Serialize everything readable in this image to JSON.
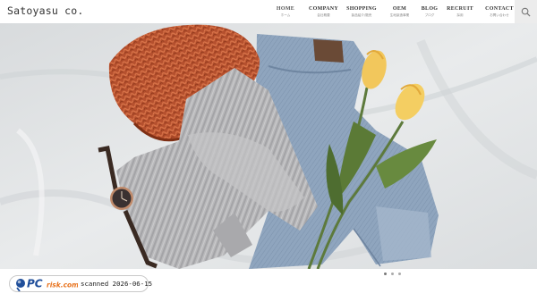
{
  "site": {
    "logo": "Satoyasu co."
  },
  "nav": [
    {
      "en": "HOME",
      "jp": "ホーム",
      "active": true
    },
    {
      "en": "COMPANY",
      "jp": "会社概要",
      "active": false
    },
    {
      "en": "SHOPPING",
      "jp": "製品紹介/販売",
      "active": false
    },
    {
      "en": "OEM",
      "jp": "生地製造事業",
      "active": false
    },
    {
      "en": "BLOG",
      "jp": "ブログ",
      "active": false
    },
    {
      "en": "RECRUIT",
      "jp": "採用",
      "active": false
    },
    {
      "en": "CONTACT",
      "jp": "お問い合わせ",
      "active": false
    }
  ],
  "search": {
    "icon": "search-icon"
  },
  "slider": {
    "dots": 3,
    "active_index": 0
  },
  "watermark": {
    "logo_text": "PCrisk.com",
    "scan_text": "scanned 2026-06-15"
  },
  "colors": {
    "hero_bg": "#e3e5e6",
    "knit_hat": "#b5502e",
    "sweater": "#b6b6b8",
    "jeans": "#8ea4bd",
    "tulip": "#f2c75c",
    "stem": "#5d7a3c",
    "watch_strap": "#3a2a22"
  }
}
